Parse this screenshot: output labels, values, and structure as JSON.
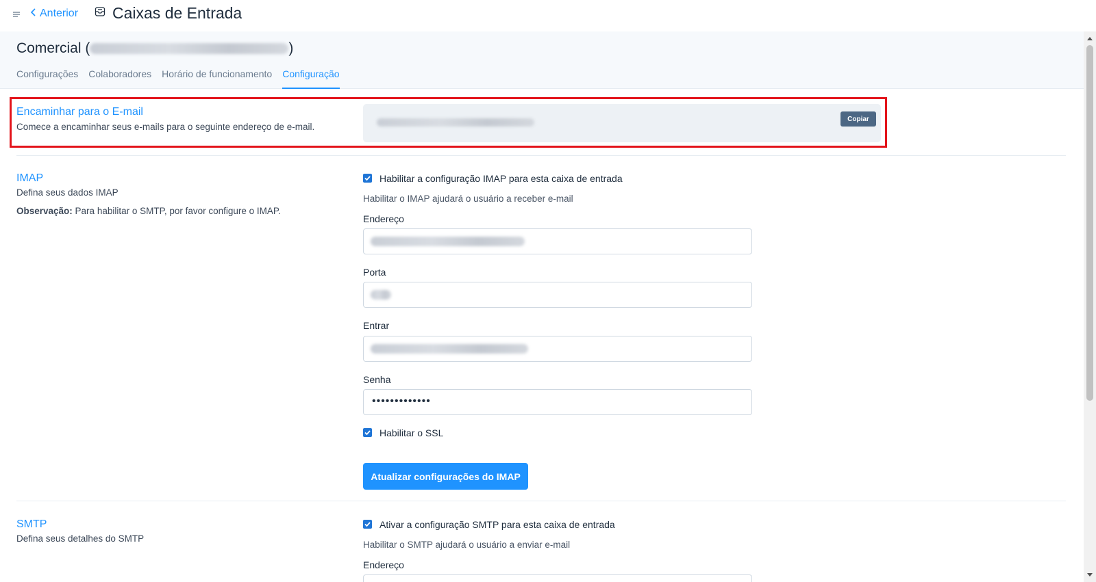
{
  "topbar": {
    "menu_icon": "hamburger-icon",
    "back_label": "Anterior",
    "title": "Caixas de Entrada",
    "title_icon": "inbox-icon"
  },
  "inbox": {
    "name_prefix": "Comercial (",
    "name_suffix": ")"
  },
  "tabs": [
    {
      "label": "Configurações",
      "active": false
    },
    {
      "label": "Colaboradores",
      "active": false
    },
    {
      "label": "Horário de funcionamento",
      "active": false
    },
    {
      "label": "Configuração",
      "active": true
    }
  ],
  "forward": {
    "title": "Encaminhar para o E-mail",
    "description": "Comece a encaminhar seus e-mails para o seguinte endereço de e-mail.",
    "copy_label": "Copiar"
  },
  "imap": {
    "title": "IMAP",
    "description": "Defina seus dados IMAP",
    "note_label": "Observação:",
    "note_text": " Para habilitar o SMTP, por favor configure o IMAP.",
    "enable_label": "Habilitar a configuração IMAP para esta caixa de entrada",
    "enable_checked": true,
    "help": "Habilitar o IMAP ajudará o usuário a receber e-mail",
    "address_label": "Endereço",
    "port_label": "Porta",
    "login_label": "Entrar",
    "password_label": "Senha",
    "password_value": "•••••••••••••",
    "ssl_label": "Habilitar o SSL",
    "ssl_checked": true,
    "update_button": "Atualizar configurações do IMAP"
  },
  "smtp": {
    "title": "SMTP",
    "description": "Defina seus detalhes do SMTP",
    "enable_label": "Ativar a configuração SMTP para esta caixa de entrada",
    "enable_checked": true,
    "help": "Habilitar o SMTP ajudará o usuário a enviar e-mail",
    "address_label": "Endereço"
  },
  "colors": {
    "accent": "#1f93ff",
    "highlight": "#e3141b",
    "copy_button": "#4c6784"
  }
}
